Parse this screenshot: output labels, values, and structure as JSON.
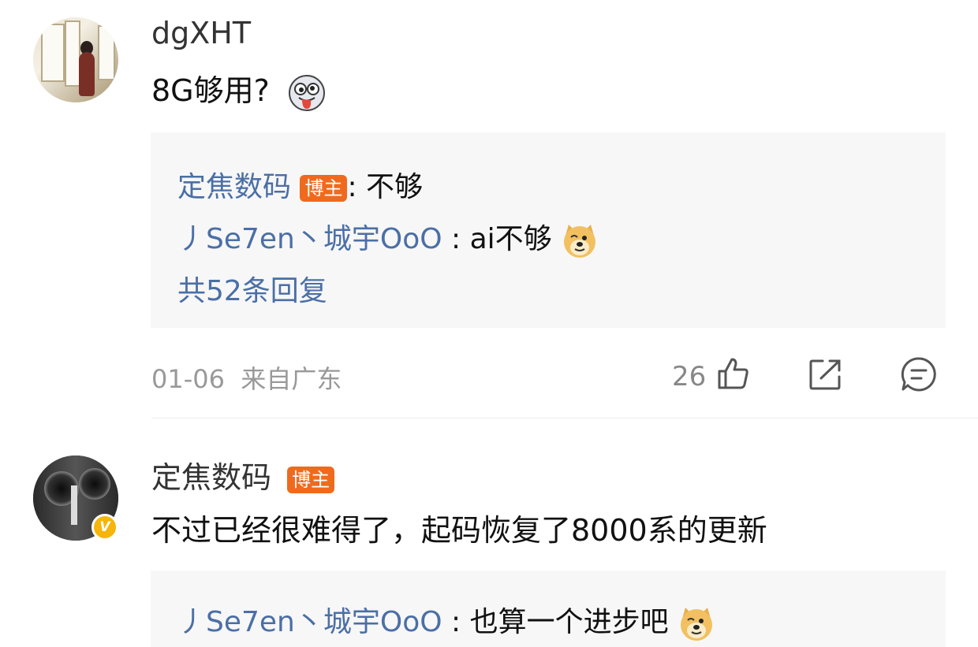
{
  "comments": [
    {
      "username": "dgXHT",
      "text": "8G够用?",
      "emoji": "tongue-out-face-emoji",
      "replies": [
        {
          "author": "定焦数码",
          "badge": "博主",
          "text": ": 不够"
        },
        {
          "author": "丿Se7en丶城宇OoO",
          "text": " : ai不够",
          "emoji": "doge-emoji"
        }
      ],
      "more_replies": "共52条回复",
      "date": "01-06",
      "location": "来自广东",
      "likes": "26"
    },
    {
      "username": "定焦数码",
      "badge": "博主",
      "verified": "V",
      "text": "不过已经很难得了，起码恢复了8000系的更新",
      "replies": [
        {
          "author": "丿Se7en丶城宇OoO",
          "text": " : 也算一个进步吧",
          "emoji": "doge-emoji"
        }
      ]
    }
  ],
  "colors": {
    "link": "#4b6fa6",
    "badge": "#f06a1e",
    "verified": "#f5b50b",
    "reply_bg": "#f7f7f7"
  }
}
